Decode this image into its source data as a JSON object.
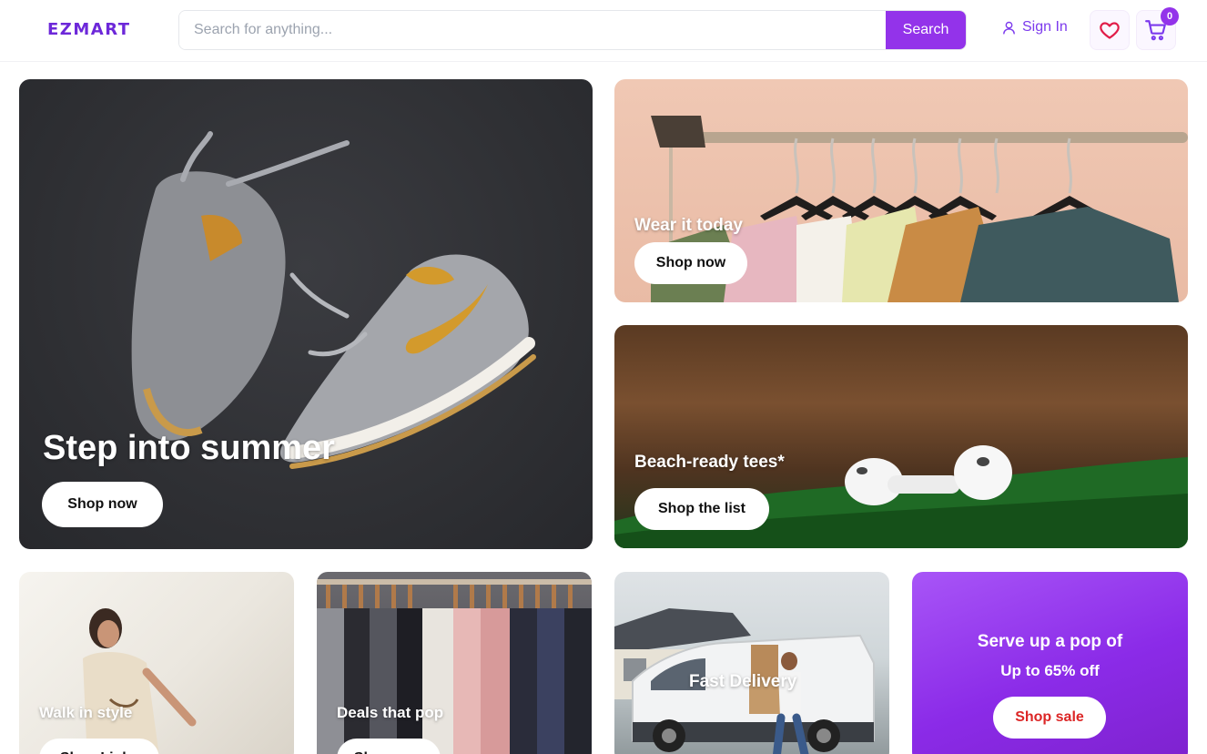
{
  "header": {
    "logo": "EZMART",
    "search": {
      "placeholder": "Search for anything...",
      "value": "",
      "button_label": "Search"
    },
    "signin_label": "Sign In",
    "cart_count": "0"
  },
  "tiles": {
    "hero": {
      "title": "Step into summer",
      "button_label": "Shop now"
    },
    "wear": {
      "title": "Wear it today",
      "button_label": "Shop now"
    },
    "beach": {
      "title": "Beach-ready tees*",
      "button_label": "Shop the list"
    },
    "walk": {
      "title": "Walk in style",
      "button_label": "Shop Links"
    },
    "deals": {
      "title": "Deals that pop",
      "button_label": "Shop now"
    },
    "fast": {
      "title": "Fast Delivery"
    },
    "promo": {
      "title": "Serve up a pop of",
      "subtitle": "Up to 65% off",
      "button_label": "Shop sale"
    }
  },
  "colors": {
    "brand": "#7c3aed",
    "search_button": "#9333ea",
    "promo_bg": "#9333ea",
    "sale_text": "#dc2626",
    "wishlist_icon": "#e11d48"
  },
  "icons": {
    "signin": "user-icon",
    "wishlist": "heart-icon",
    "cart": "cart-icon"
  }
}
